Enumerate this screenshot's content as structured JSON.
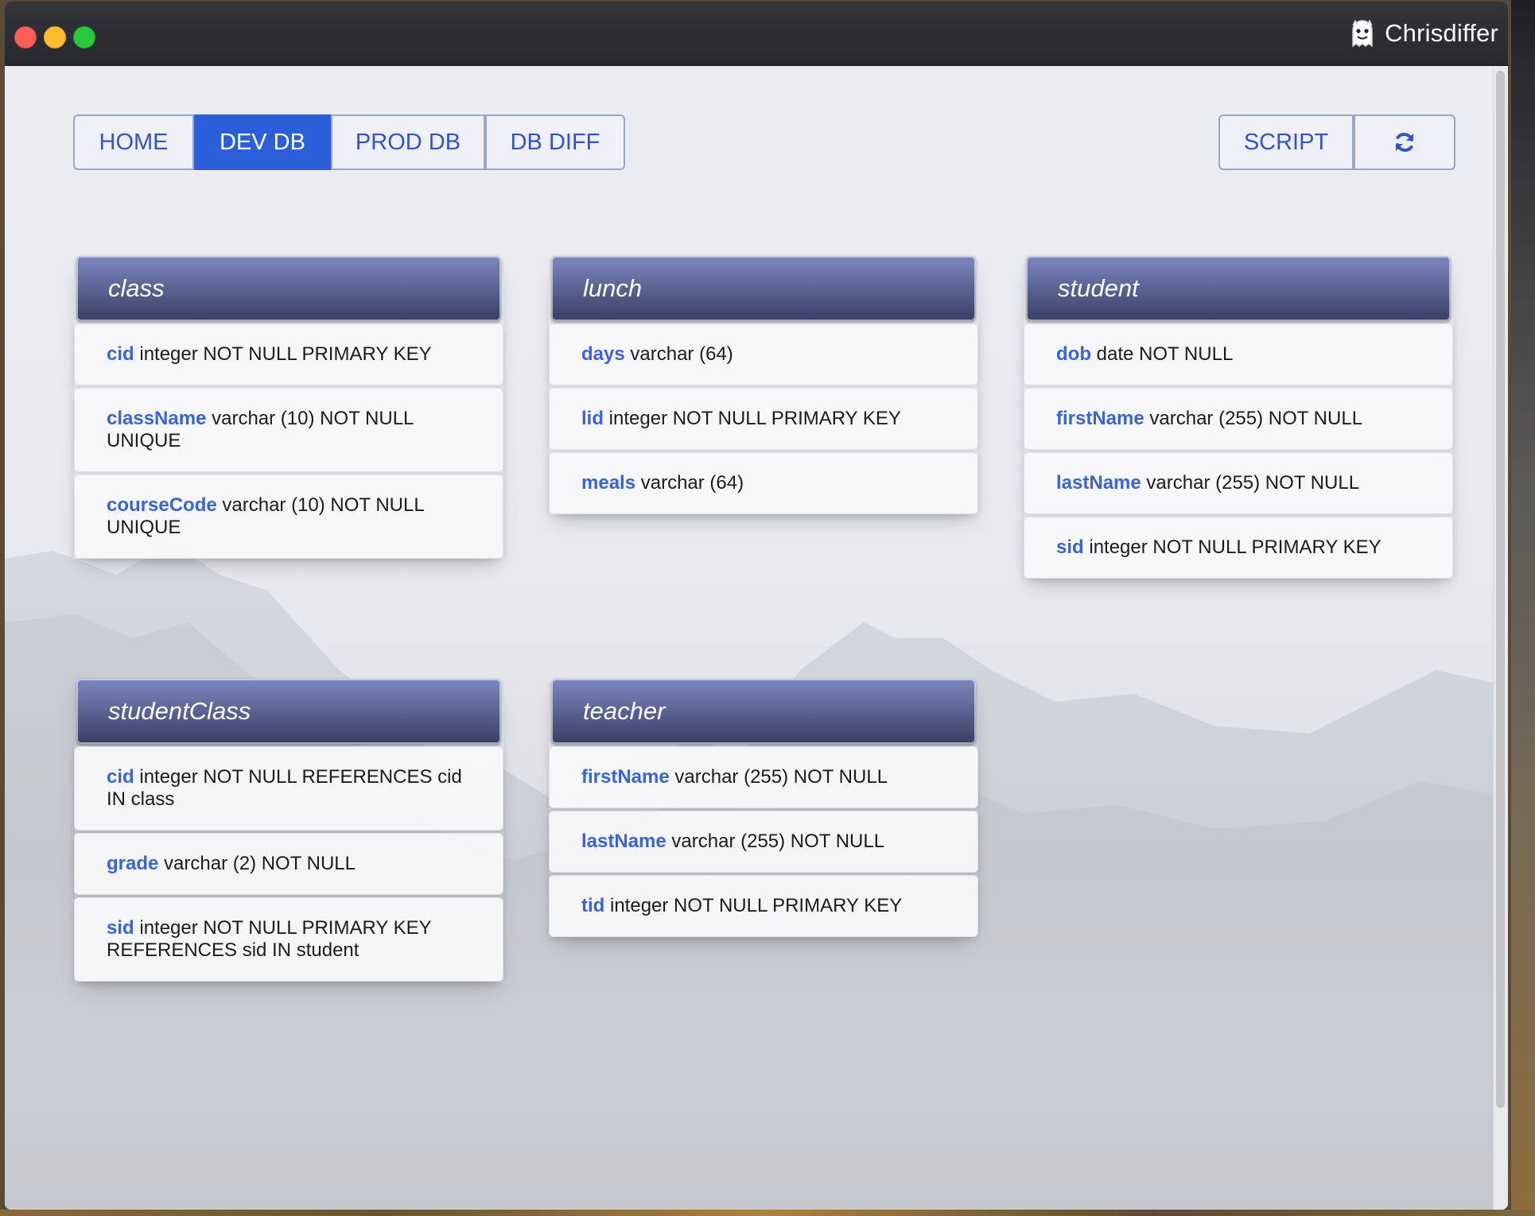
{
  "app": {
    "name": "Chrisdiffer",
    "logo_icon": "ghost-icon"
  },
  "nav": {
    "tabs": [
      {
        "label": "HOME",
        "active": false
      },
      {
        "label": "DEV DB",
        "active": true
      },
      {
        "label": "PROD DB",
        "active": false
      },
      {
        "label": "DB DIFF",
        "active": false
      }
    ],
    "script_label": "SCRIPT",
    "refresh_icon": "refresh-icon"
  },
  "colors": {
    "accent": "#2b5fd9",
    "field_name": "#3a64d6",
    "header_gradient": [
      "#7d88c0",
      "#373f63"
    ]
  },
  "tables": [
    {
      "name": "class",
      "fields": [
        {
          "name": "cid",
          "def": "integer NOT NULL PRIMARY KEY"
        },
        {
          "name": "className",
          "def": "varchar (10) NOT NULL UNIQUE"
        },
        {
          "name": "courseCode",
          "def": "varchar (10) NOT NULL UNIQUE"
        }
      ]
    },
    {
      "name": "lunch",
      "fields": [
        {
          "name": "days",
          "def": "varchar (64)"
        },
        {
          "name": "lid",
          "def": "integer NOT NULL PRIMARY KEY"
        },
        {
          "name": "meals",
          "def": "varchar (64)"
        }
      ]
    },
    {
      "name": "student",
      "fields": [
        {
          "name": "dob",
          "def": "date NOT NULL"
        },
        {
          "name": "firstName",
          "def": "varchar (255) NOT NULL"
        },
        {
          "name": "lastName",
          "def": "varchar (255) NOT NULL"
        },
        {
          "name": "sid",
          "def": "integer NOT NULL PRIMARY KEY"
        }
      ]
    },
    {
      "name": "studentClass",
      "fields": [
        {
          "name": "cid",
          "def": "integer NOT NULL REFERENCES cid IN class"
        },
        {
          "name": "grade",
          "def": "varchar (2) NOT NULL"
        },
        {
          "name": "sid",
          "def": "integer NOT NULL PRIMARY KEY REFERENCES sid IN student"
        }
      ]
    },
    {
      "name": "teacher",
      "fields": [
        {
          "name": "firstName",
          "def": "varchar (255) NOT NULL"
        },
        {
          "name": "lastName",
          "def": "varchar (255) NOT NULL"
        },
        {
          "name": "tid",
          "def": "integer NOT NULL PRIMARY KEY"
        }
      ]
    }
  ]
}
